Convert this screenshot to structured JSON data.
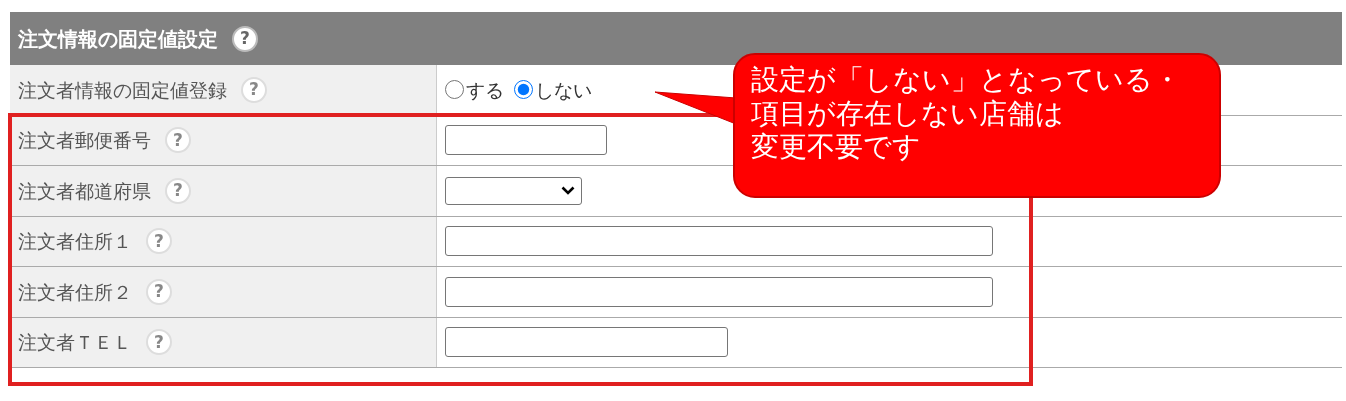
{
  "section": {
    "title": "注文情報の固定値設定",
    "help": "?"
  },
  "rows": [
    {
      "label": "注文者情報の固定値登録",
      "help": "?",
      "kind": "radio",
      "options": [
        {
          "label": "する",
          "selected": false
        },
        {
          "label": "しない",
          "selected": true
        }
      ]
    },
    {
      "label": "注文者郵便番号",
      "help": "?",
      "kind": "text"
    },
    {
      "label": "注文者都道府県",
      "help": "?",
      "kind": "select"
    },
    {
      "label": "注文者住所１",
      "help": "?",
      "kind": "text"
    },
    {
      "label": "注文者住所２",
      "help": "?",
      "kind": "text"
    },
    {
      "label": "注文者ＴＥＬ",
      "help": "?",
      "kind": "text"
    }
  ],
  "callout": {
    "lines": [
      "設定が「しない」となっている・",
      "項目が存在しない店舗は",
      "変更不要です"
    ]
  }
}
